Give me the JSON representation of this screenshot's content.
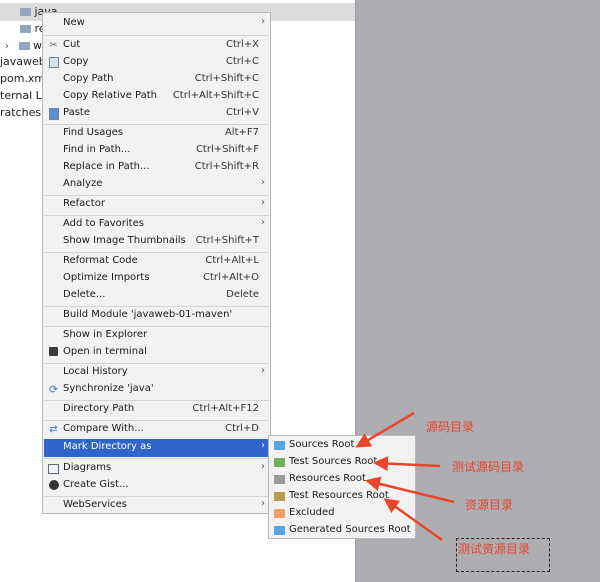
{
  "tree": {
    "rows": [
      "java",
      "re",
      "w",
      "javaweb",
      "pom.xm",
      "ternal Lib",
      "ratches a"
    ]
  },
  "menu": {
    "items": [
      {
        "label": "New",
        "shortcut": "",
        "arrow": true,
        "icon": ""
      },
      {
        "label": "Cut",
        "shortcut": "Ctrl+X",
        "arrow": false,
        "icon": "scissors-icon"
      },
      {
        "label": "Copy",
        "shortcut": "Ctrl+C",
        "arrow": false,
        "icon": "copy-icon"
      },
      {
        "label": "Copy Path",
        "shortcut": "Ctrl+Shift+C",
        "arrow": false,
        "icon": ""
      },
      {
        "label": "Copy Relative Path",
        "shortcut": "Ctrl+Alt+Shift+C",
        "arrow": false,
        "icon": ""
      },
      {
        "label": "Paste",
        "shortcut": "Ctrl+V",
        "arrow": false,
        "icon": "paste-icon"
      },
      {
        "label": "Find Usages",
        "shortcut": "Alt+F7",
        "arrow": false,
        "icon": ""
      },
      {
        "label": "Find in Path...",
        "shortcut": "Ctrl+Shift+F",
        "arrow": false,
        "icon": ""
      },
      {
        "label": "Replace in Path...",
        "shortcut": "Ctrl+Shift+R",
        "arrow": false,
        "icon": ""
      },
      {
        "label": "Analyze",
        "shortcut": "",
        "arrow": true,
        "icon": ""
      },
      {
        "label": "Refactor",
        "shortcut": "",
        "arrow": true,
        "icon": ""
      },
      {
        "label": "Add to Favorites",
        "shortcut": "",
        "arrow": true,
        "icon": ""
      },
      {
        "label": "Show Image Thumbnails",
        "shortcut": "Ctrl+Shift+T",
        "arrow": false,
        "icon": ""
      },
      {
        "label": "Reformat Code",
        "shortcut": "Ctrl+Alt+L",
        "arrow": false,
        "icon": ""
      },
      {
        "label": "Optimize Imports",
        "shortcut": "Ctrl+Alt+O",
        "arrow": false,
        "icon": ""
      },
      {
        "label": "Delete...",
        "shortcut": "Delete",
        "arrow": false,
        "icon": ""
      },
      {
        "label": "Build Module 'javaweb-01-maven'",
        "shortcut": "",
        "arrow": false,
        "icon": ""
      },
      {
        "label": "Show in Explorer",
        "shortcut": "",
        "arrow": false,
        "icon": ""
      },
      {
        "label": "Open in terminal",
        "shortcut": "",
        "arrow": false,
        "icon": "terminal-icon"
      },
      {
        "label": "Local History",
        "shortcut": "",
        "arrow": true,
        "icon": ""
      },
      {
        "label": "Synchronize 'java'",
        "shortcut": "",
        "arrow": false,
        "icon": "sync-icon"
      },
      {
        "label": "Directory Path",
        "shortcut": "Ctrl+Alt+F12",
        "arrow": false,
        "icon": ""
      },
      {
        "label": "Compare With...",
        "shortcut": "Ctrl+D",
        "arrow": false,
        "icon": "compare-icon"
      },
      {
        "label": "Mark Directory as",
        "shortcut": "",
        "arrow": true,
        "icon": ""
      },
      {
        "label": "Diagrams",
        "shortcut": "",
        "arrow": true,
        "icon": "diagram-icon"
      },
      {
        "label": "Create Gist...",
        "shortcut": "",
        "arrow": false,
        "icon": "github-icon"
      },
      {
        "label": "WebServices",
        "shortcut": "",
        "arrow": true,
        "icon": ""
      }
    ]
  },
  "submenu": {
    "items": [
      {
        "label": "Sources Root",
        "color": "#5aa5e0"
      },
      {
        "label": "Test Sources Root",
        "color": "#6fae5a"
      },
      {
        "label": "Resources Root",
        "color": "#9a9a9a"
      },
      {
        "label": "Test Resources Root",
        "color": "#b99a4f"
      },
      {
        "label": "Excluded",
        "color": "#f0a06a"
      },
      {
        "label": "Generated Sources Root",
        "color": "#5aa5e0"
      }
    ]
  },
  "notes": {
    "sources": "源码目录",
    "test_sources": "测试源码目录",
    "resources": "资源目录",
    "test_resources": "测试资源目录"
  },
  "colors": {
    "highlight": "#2f65ca",
    "annotation": "#e8452a"
  }
}
